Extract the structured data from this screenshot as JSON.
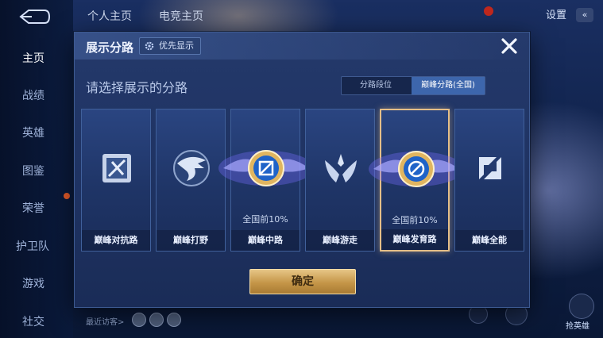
{
  "background": {
    "tabs": [
      "个人主页",
      "电竞主页"
    ],
    "settings_label": "设置",
    "chevron": "«",
    "visitors_label": "最近访客>",
    "right_label": "抢英雄"
  },
  "sidebar": {
    "items": [
      {
        "label": "主页",
        "active": true
      },
      {
        "label": "战绩"
      },
      {
        "label": "英雄"
      },
      {
        "label": "图鉴"
      },
      {
        "label": "荣誉"
      },
      {
        "label": "护卫队"
      },
      {
        "label": "游戏"
      },
      {
        "label": "社交"
      }
    ]
  },
  "modal": {
    "title": "展示分路",
    "priority_label": "优先显示",
    "subtitle": "请选择展示的分路",
    "toggle": {
      "options": [
        "分路段位",
        "巅峰分路(全国)"
      ],
      "selected_index": 1
    },
    "cards": [
      {
        "label": "巅峰对抗路",
        "rank": "",
        "icon": "clash-lane-icon",
        "badge": "silver",
        "selected": false
      },
      {
        "label": "巅峰打野",
        "rank": "",
        "icon": "jungle-dragon-icon",
        "badge": "silver",
        "selected": false
      },
      {
        "label": "巅峰中路",
        "rank": "全国前10%",
        "icon": "mid-lane-icon",
        "badge": "gold",
        "selected": false
      },
      {
        "label": "巅峰游走",
        "rank": "",
        "icon": "roam-wings-icon",
        "badge": "silver",
        "selected": false
      },
      {
        "label": "巅峰发育路",
        "rank": "全国前10%",
        "icon": "farm-lane-icon",
        "badge": "gold",
        "selected": true
      },
      {
        "label": "巅峰全能",
        "rank": "",
        "icon": "all-round-icon",
        "badge": "silver",
        "selected": false
      }
    ],
    "confirm_label": "确定",
    "close_icon": "close-icon"
  },
  "colors": {
    "accent_gold": "#e5bf88",
    "toggle_selected": "#3d66ac",
    "panel": "#1e3261"
  }
}
